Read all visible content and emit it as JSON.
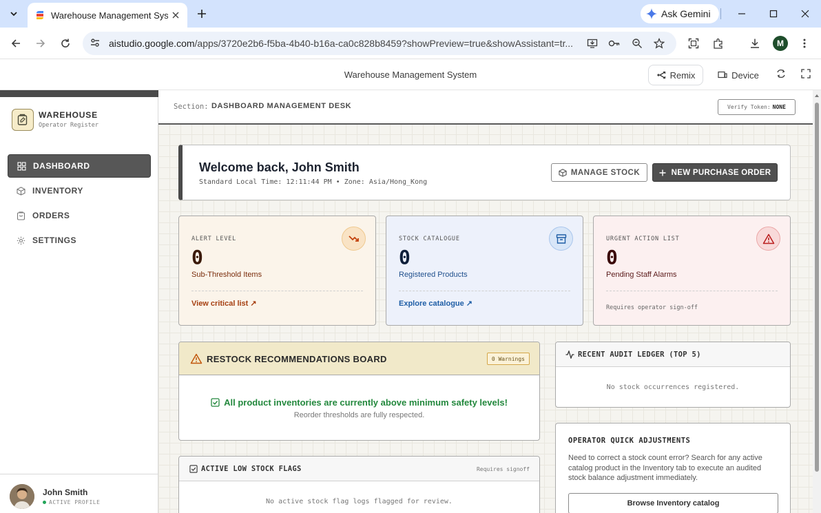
{
  "browser": {
    "tab_title": "Warehouse Management System",
    "url_host": "aistudio.google.com",
    "url_path": "/apps/3720e2b6-f5ba-4b40-b16a-ca0c828b8459?showPreview=true&showAssistant=tr...",
    "ask_gemini": "Ask Gemini",
    "profile_initial": "M"
  },
  "studio": {
    "title": "Warehouse Management System",
    "remix": "Remix",
    "device": "Device"
  },
  "sidebar": {
    "brand": "WAREHOUSE",
    "brand_sub": "Operator Register",
    "items": [
      {
        "label": "DASHBOARD",
        "icon": "grid-icon"
      },
      {
        "label": "INVENTORY",
        "icon": "box-icon"
      },
      {
        "label": "ORDERS",
        "icon": "clipboard-icon"
      },
      {
        "label": "SETTINGS",
        "icon": "gear-icon"
      }
    ],
    "profile": {
      "name": "John Smith",
      "status": "ACTIVE PROFILE"
    }
  },
  "header": {
    "section_label": "Section:",
    "section_value": "DASHBOARD MANAGEMENT DESK",
    "verify_label": "Verify Token:",
    "verify_value": "NONE"
  },
  "welcome": {
    "title": "Welcome back, John Smith",
    "subtitle": "Standard Local Time: 12:11:44 PM • Zone: Asia/Hong_Kong",
    "manage_stock": "MANAGE STOCK",
    "new_po": "NEW PURCHASE ORDER"
  },
  "stats": [
    {
      "label": "ALERT LEVEL",
      "value": "0",
      "desc": "Sub-Threshold Items",
      "link": "View critical list ↗",
      "bg": "#fbf4ea",
      "icon_bg": "#f9e3c5",
      "accent": "#a64012"
    },
    {
      "label": "STOCK CATALOGUE",
      "value": "0",
      "desc": "Registered Products",
      "link": "Explore catalogue ↗",
      "bg": "#edf1fb",
      "icon_bg": "#d8e6f8",
      "accent": "#1f5ea6"
    },
    {
      "label": "URGENT ACTION LIST",
      "value": "0",
      "desc": "Pending Staff Alarms",
      "note": "Requires operator sign-off",
      "bg": "#fcf0f0",
      "icon_bg": "#f8d9d9",
      "accent": "#a61f1f"
    }
  ],
  "restock": {
    "title": "RESTOCK RECOMMENDATIONS BOARD",
    "badge": "0 Warnings",
    "ok": "All product inventories are currently above minimum safety levels!",
    "ok_sub": "Reorder thresholds are fully respected."
  },
  "audit": {
    "title": "RECENT AUDIT LEDGER (TOP 5)",
    "empty": "No stock occurrences registered."
  },
  "quick": {
    "title": "OPERATOR QUICK ADJUSTMENTS",
    "text": "Need to correct a stock count error? Search for any active catalog product in the Inventory tab to execute an audited stock balance adjustment immediately.",
    "button": "Browse Inventory catalog"
  },
  "flags": {
    "title": "ACTIVE LOW STOCK FLAGS",
    "note": "Requires signoff",
    "empty": "No active stock flag logs flagged for review."
  }
}
